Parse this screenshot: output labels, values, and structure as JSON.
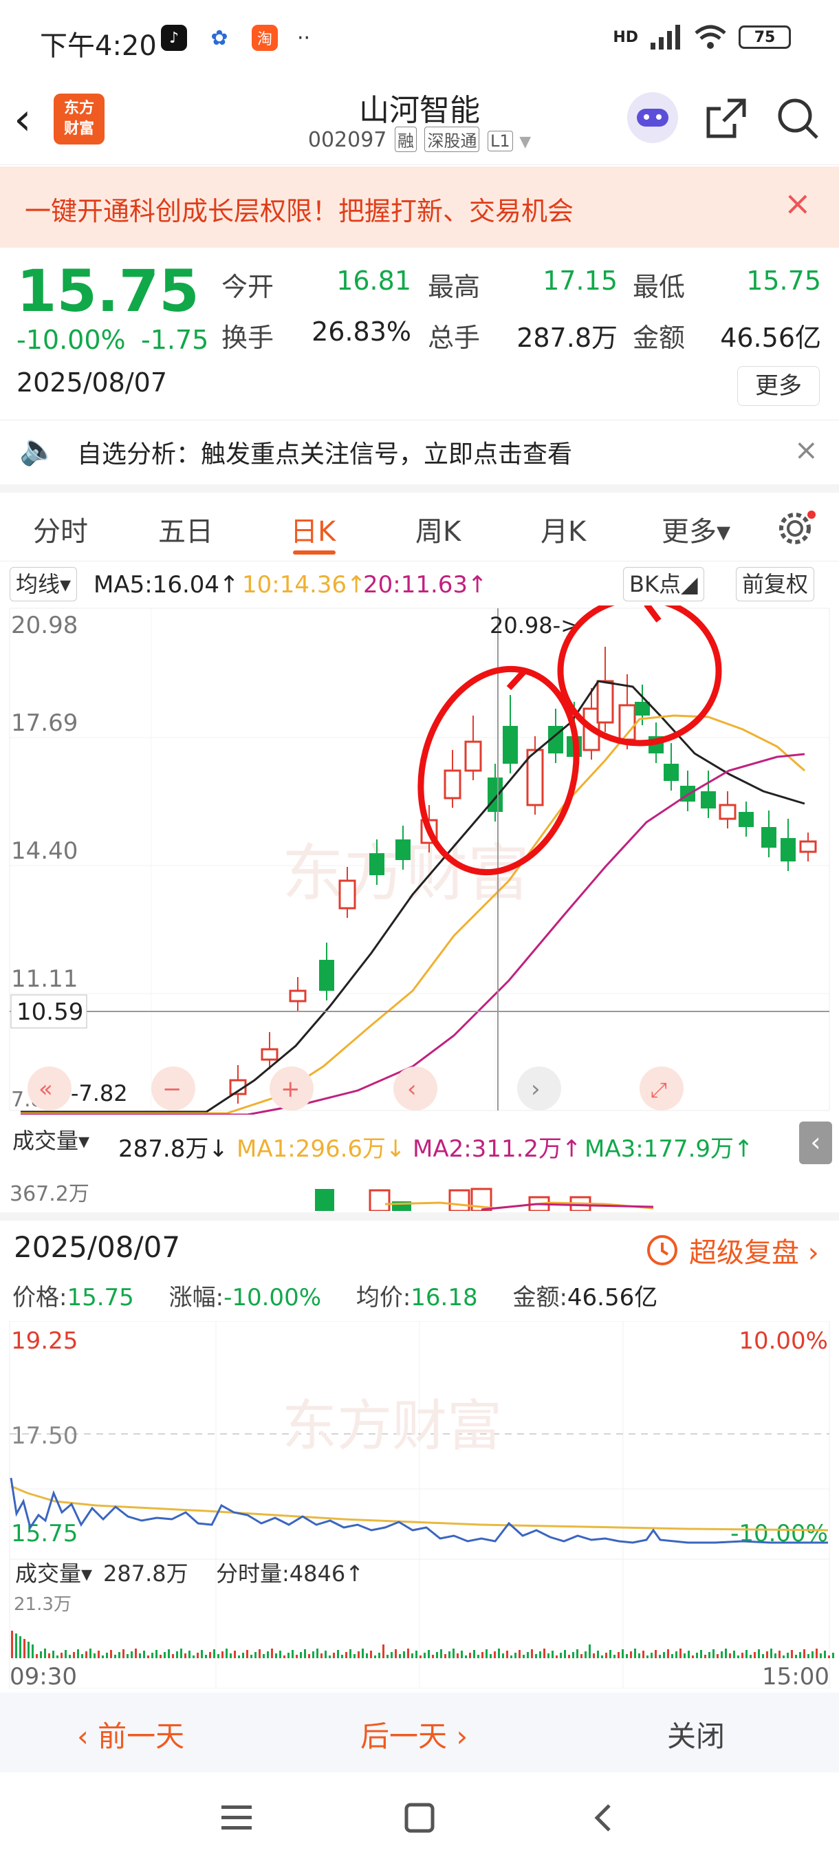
{
  "status_bar": {
    "time": "下午4:20",
    "app1": "♪",
    "app2": "淘",
    "dots": "··",
    "network": "HD",
    "battery": "75"
  },
  "header": {
    "back": "‹",
    "logo_line1": "东方",
    "logo_line2": "财富",
    "stock_name": "山河智能",
    "stock_code": "002097",
    "tag1": "融",
    "tag2": "深股通",
    "tag3": "L1"
  },
  "banner": {
    "text": "一键开通科创成长层权限！把握打新、交易机会",
    "close": "×"
  },
  "quote": {
    "price": "15.75",
    "change_pct": "-10.00%",
    "change": "-1.75",
    "date": "2025/08/07",
    "open_label": "今开",
    "open": "16.81",
    "high_label": "最高",
    "high": "17.15",
    "low_label": "最低",
    "low": "15.75",
    "turnover_label": "换手",
    "turnover": "26.83%",
    "volume_label": "总手",
    "volume": "287.8万",
    "amount_label": "金额",
    "amount": "46.56亿",
    "more": "更多"
  },
  "analysis": {
    "text": "自选分析：触发重点关注信号，立即点击查看",
    "close": "×"
  },
  "tabs": [
    "分时",
    "五日",
    "日K",
    "周K",
    "月K",
    "更多▾"
  ],
  "ma_bar": {
    "select": "均线▾",
    "ma5": "MA5:16.04↑",
    "ma10": "10:14.36↑",
    "ma20": "20:11.63↑",
    "bk": "BK点◢",
    "fuquan": "前复权"
  },
  "kchart": {
    "y_labels": [
      "20.98",
      "17.69",
      "14.40",
      "11.11",
      "7.82"
    ],
    "crosshair_price": "10.59",
    "high_marker": "20.98->",
    "low_marker": "<-7.82",
    "colors": {
      "up": "#e03d2f",
      "down": "#11a84a",
      "ma5": "#222222",
      "ma10": "#f0b030",
      "ma20": "#c0217e"
    }
  },
  "volume_bar": {
    "select": "成交量▾",
    "vol": "287.8万↓",
    "ma1": "MA1:296.6万↓",
    "ma2": "MA2:311.2万↑",
    "ma3": "MA3:177.9万↑",
    "axis_max": "367.2万"
  },
  "review": {
    "date": "2025/08/07",
    "super": "超级复盘 ›",
    "price_label": "价格:",
    "price": "15.75",
    "chg_label": "涨幅:",
    "chg": "-10.00%",
    "avg_label": "均价:",
    "avg": "16.18",
    "amt_label": "金额:",
    "amt": "46.56亿"
  },
  "mini": {
    "y_top": "19.25",
    "y_mid": "17.50",
    "y_bot": "15.75",
    "pct_top": "10.00%",
    "pct_bot": "-10.00%",
    "vol_label": "成交量▾",
    "vol": "287.8万",
    "tick_label": "分时量:4846↑",
    "vol_max": "21.3万",
    "t_start": "09:30",
    "t_end": "15:00"
  },
  "bottom": {
    "prev": "‹ 前一天",
    "next": "后一天 ›",
    "close": "关闭"
  },
  "watermark": "东方财富"
}
